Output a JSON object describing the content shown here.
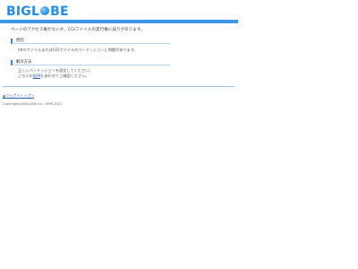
{
  "header": {
    "logo_left": "BIGL",
    "logo_right": "BE"
  },
  "main_message": "ページのアクセス権がないか、CGIファイルの実行権に誤りがあります。",
  "sections": {
    "cause": {
      "title": "原因",
      "text": "htmlファイルまたはCGIファイルのパーミッションに問題があります。"
    },
    "solution": {
      "title": "解決方法",
      "line1": "正しいパーミッションを設定してください。",
      "line2_before": "こちらの",
      "line2_link": "説明",
      "line2_after": "もあわせてご確認ください。"
    }
  },
  "footer": {
    "home_link": "▲ウェブリトップへ",
    "copyright": "Copyright(c)BIGLOBE Inc. 1996-2021"
  },
  "colors": {
    "accent": "#3d95e8",
    "logo": "#1f8ee6",
    "link": "#2a62b8"
  }
}
